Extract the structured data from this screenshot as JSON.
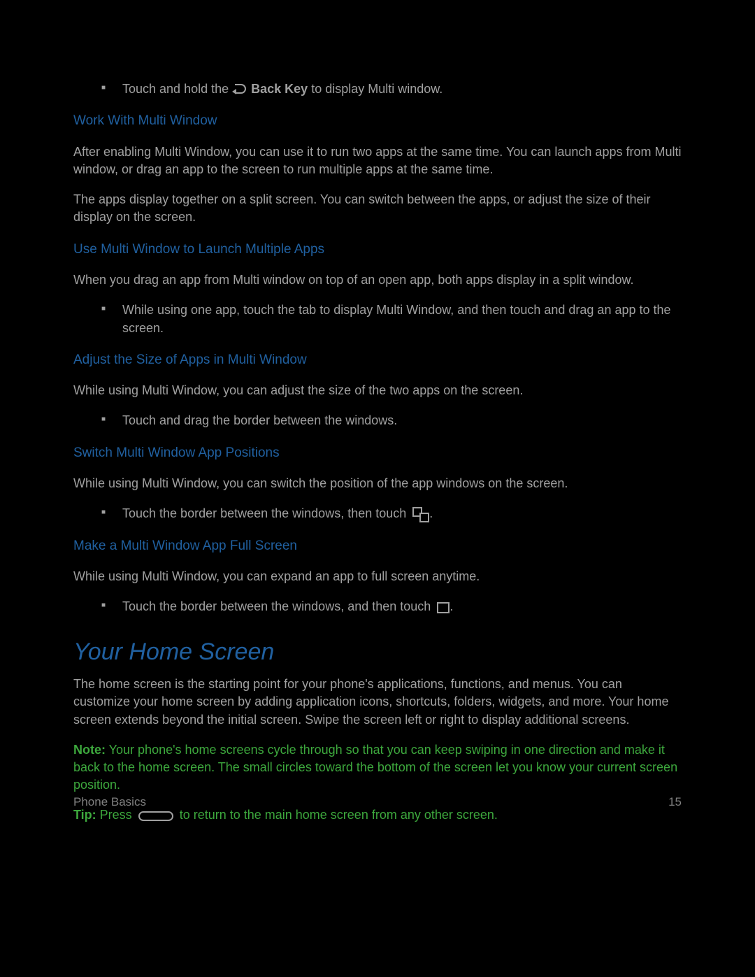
{
  "bullet1_pre": "Touch and hold the ",
  "bullet1_mid": "Back Key",
  "bullet1_post": " to display Multi window.",
  "heading1": "Work With Multi Window",
  "para1": "After enabling Multi Window, you can use it to run two apps at the same time. You can launch apps from Multi window, or drag an app to the screen to run multiple apps at the same time.",
  "para2": "The apps display together on a split screen. You can switch between the apps, or adjust the size of their display on the screen.",
  "heading2": "Use Multi Window to Launch Multiple Apps",
  "para3": "When you drag an app from Multi window on top of an open app, both apps display in a split window.",
  "bullet2": "While using one app, touch the tab to display Multi Window, and then touch and drag an app to the screen.",
  "heading3": "Adjust the Size of Apps in Multi Window",
  "para4": "While using Multi Window, you can adjust the size of the two apps on the screen.",
  "bullet3": "Touch and drag the border between the windows.",
  "heading4": "Switch Multi Window App Positions",
  "para5": "While using Multi Window, you can switch the position of the app windows on the screen.",
  "bullet4": "Touch the border between the windows, then touch ",
  "heading5": "Make a Multi Window App Full Screen",
  "para6": "While using Multi Window, you can expand an app to full screen anytime.",
  "bullet5": "Touch the border between the windows, and then touch ",
  "mainHeading": "Your Home Screen",
  "para7": "The home screen is the starting point for your phone's applications, functions, and menus. You can customize your home screen by adding application icons, shortcuts, folders, widgets, and more. Your home screen extends beyond the initial screen. Swipe the screen left or right to display additional screens.",
  "noteLabel": "Note:",
  "noteText": " Your phone's home screens cycle through so that you can keep swiping in one direction and make it back to the home screen. The small circles toward the bottom of the screen let you know your current screen position.",
  "tipLabel": "Tip:",
  "tipPre": " Press ",
  "tipPost": " to return to the main home screen from any other screen.",
  "footerLeft": "Phone Basics",
  "footerRight": "15"
}
